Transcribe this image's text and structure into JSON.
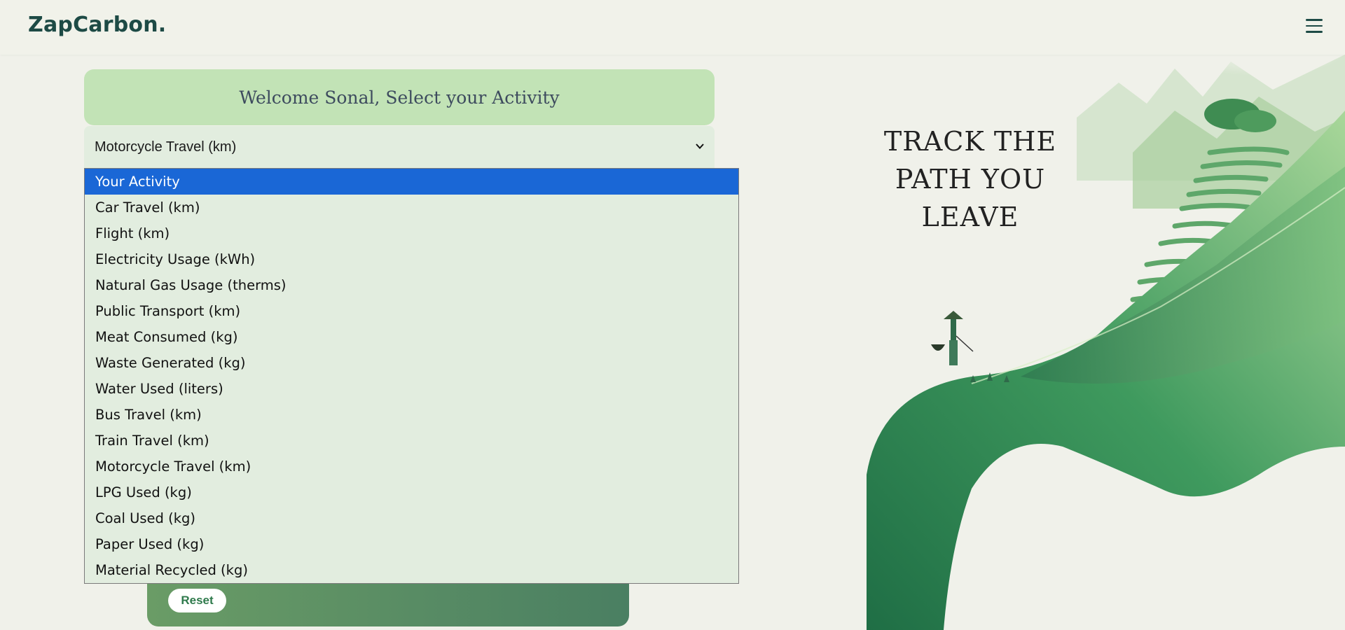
{
  "header": {
    "logo": "ZapCarbon.",
    "menu_icon": "hamburger-menu-icon"
  },
  "welcome": {
    "text": "Welcome Sonal, Select your Activity"
  },
  "activity_select": {
    "selected_value": "Motorcycle Travel (km)",
    "chevron_icon": "chevron-down-icon",
    "options": [
      "Your Activity",
      "Car Travel (km)",
      "Flight (km)",
      "Electricity Usage (kWh)",
      "Natural Gas Usage (therms)",
      "Public Transport (km)",
      "Meat Consumed (kg)",
      "Waste Generated (kg)",
      "Water Used (liters)",
      "Bus Travel (km)",
      "Train Travel (km)",
      "Motorcycle Travel (km)",
      "LPG Used (kg)",
      "Coal Used (kg)",
      "Paper Used (kg)",
      "Material Recycled (kg)"
    ],
    "highlighted_option": "Your Activity"
  },
  "form": {
    "reset_label": "Reset"
  },
  "hero": {
    "tagline_lines": [
      "TRACK THE",
      "PATH YOU",
      "LEAVE"
    ]
  },
  "colors": {
    "brand": "#1d4a45",
    "welcome_bg": "#c2e3b6",
    "select_bg": "#e2eddf",
    "highlight": "#1a67d6",
    "card_gradient_start": "#6a9c66",
    "card_gradient_end": "#4a7f62"
  }
}
